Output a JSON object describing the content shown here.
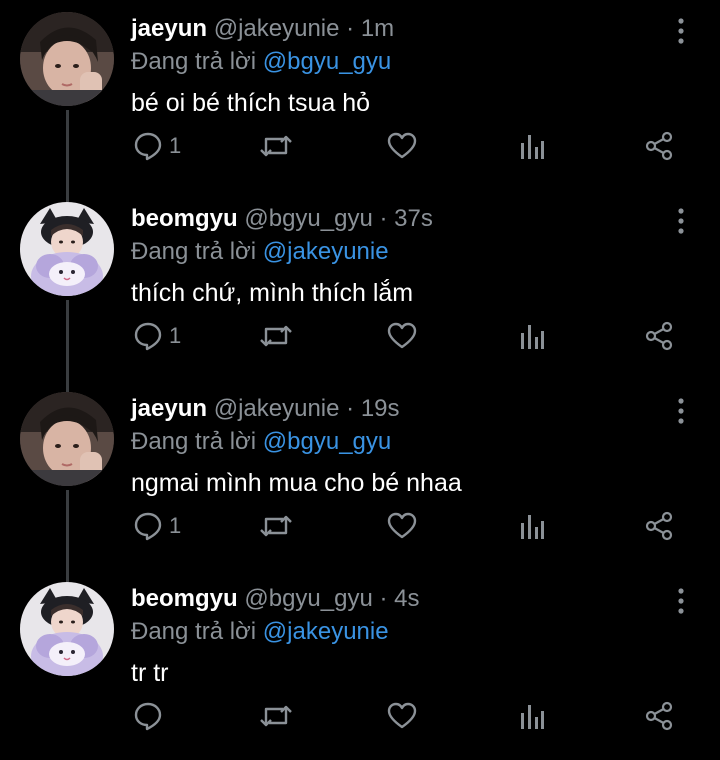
{
  "colors": {
    "background": "#000000",
    "text": "#ffffff",
    "muted": "#8b9197",
    "mention": "#3a93e3",
    "thread_line": "#3a3d40"
  },
  "tweets": [
    {
      "name": "jaeyun",
      "handle": "@jakeyunie",
      "separator": "·",
      "time": "1m",
      "reply_prefix": "Đang trả lời",
      "reply_to": "@bgyu_gyu",
      "text": "bé oi bé thích tsua hỏ",
      "reply_count": "1",
      "avatar": "jaeyun-avatar"
    },
    {
      "name": "beomgyu",
      "handle": "@bgyu_gyu",
      "separator": "·",
      "time": "37s",
      "reply_prefix": "Đang trả lời",
      "reply_to": "@jakeyunie",
      "text": "thích chứ, mình thích lắm",
      "reply_count": "1",
      "avatar": "beomgyu-avatar"
    },
    {
      "name": "jaeyun",
      "handle": "@jakeyunie",
      "separator": "·",
      "time": "19s",
      "reply_prefix": "Đang trả lời",
      "reply_to": "@bgyu_gyu",
      "text": "ngmai mình mua cho bé nhaa",
      "reply_count": "1",
      "avatar": "jaeyun-avatar"
    },
    {
      "name": "beomgyu",
      "handle": "@bgyu_gyu",
      "separator": "·",
      "time": "4s",
      "reply_prefix": "Đang trả lời",
      "reply_to": "@jakeyunie",
      "text": "tr tr",
      "reply_count": "",
      "avatar": "beomgyu-avatar"
    }
  ],
  "icons": {
    "reply": "reply-icon",
    "retweet": "retweet-icon",
    "like": "heart-icon",
    "analytics": "analytics-icon",
    "share": "share-icon",
    "more": "more-vertical-icon"
  }
}
